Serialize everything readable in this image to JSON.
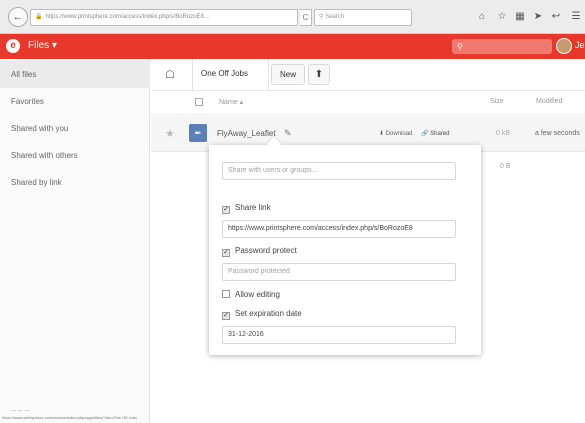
{
  "browser": {
    "back_glyph": "←",
    "url": "https://www.printsphere.com/access/index.php/s/BoRozoE8...",
    "reload_glyph": "C",
    "search_placeholder": "Search",
    "icons": [
      "home-icon",
      "star-icon",
      "library-icon",
      "send-icon",
      "pocket-icon",
      "menu-icon"
    ]
  },
  "header": {
    "app_name": "Files ▾",
    "search_glyph": "🔍",
    "user_name": "Je",
    "accent": "#e8382b"
  },
  "sidebar": {
    "items": [
      {
        "label": "All files"
      },
      {
        "label": "Favorites"
      },
      {
        "label": "Shared with you"
      },
      {
        "label": "Shared with others"
      },
      {
        "label": "Shared by link"
      }
    ],
    "footer": "... ... ..."
  },
  "breadcrumb": {
    "folder": "One Off Jobs",
    "new_label": "New",
    "upload_glyph": "⬆"
  },
  "table": {
    "col_name": "Name ▴",
    "col_size": "Size",
    "col_modified": "Modified"
  },
  "file": {
    "name": "FlyAway_Leaflet",
    "rename_glyph": "✎",
    "download_label": "⬇ Download",
    "shared_label": "🔗 Shared",
    "size": "0 kB",
    "modified": "a few seconds"
  },
  "folder_summary": "0 B",
  "share_panel": {
    "share_placeholder": "Share with users or groups...",
    "share_link_label": "Share link",
    "share_link_checked": true,
    "link_url": "https://www.printsphere.com/access/index.php/s/BoRozoE8",
    "password_label": "Password protect",
    "password_checked": true,
    "password_placeholder": "Password protected",
    "allow_editing_label": "Allow editing",
    "allow_editing_checked": false,
    "expiration_label": "Set expiration date",
    "expiration_checked": true,
    "expiration_value": "31-12-2016"
  },
  "status_bar": "https://www.printsphere.com/access/index.php/apps/files/?dir=/One Off Jobs"
}
